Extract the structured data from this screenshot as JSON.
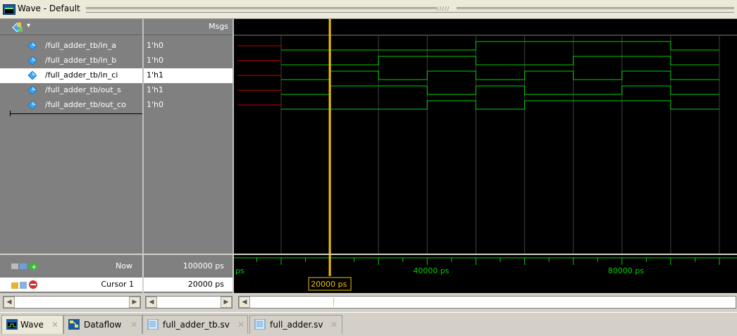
{
  "window": {
    "title": "Wave - Default",
    "grip_glyph": "/////"
  },
  "toolbar": {
    "menu_arrow": "▾"
  },
  "columns": {
    "msgs": "Msgs"
  },
  "signals": [
    {
      "name": "/full_adder_tb/in_a",
      "value": "1'h0"
    },
    {
      "name": "/full_adder_tb/in_b",
      "value": "1'h0"
    },
    {
      "name": "/full_adder_tb/in_ci",
      "value": "1'h1"
    },
    {
      "name": "/full_adder_tb/out_s",
      "value": "1'h1"
    },
    {
      "name": "/full_adder_tb/out_co",
      "value": "1'h0"
    }
  ],
  "status": {
    "now_label": "Now",
    "now_value": "100000 ps",
    "cursor_label": "Cursor 1",
    "cursor_value": "20000 ps"
  },
  "timeline": {
    "labels": [
      "ps",
      "40000 ps",
      "80000 ps"
    ],
    "cursor_time": "20000 ps"
  },
  "tabs": [
    {
      "label": "Wave",
      "icon": "wave-icon",
      "close": "✕"
    },
    {
      "label": "Dataflow",
      "icon": "dataflow-icon",
      "close": "✕"
    },
    {
      "label": "full_adder_tb.sv",
      "icon": "source-file-icon",
      "close": "✕"
    },
    {
      "label": "full_adder.sv",
      "icon": "source-file-icon",
      "close": "✕"
    }
  ],
  "colors": {
    "wave": "#00d000",
    "unknown": "#d00000",
    "cursor": "#f0c000",
    "grid": "#404040",
    "selected_row": "#ffffff"
  }
}
